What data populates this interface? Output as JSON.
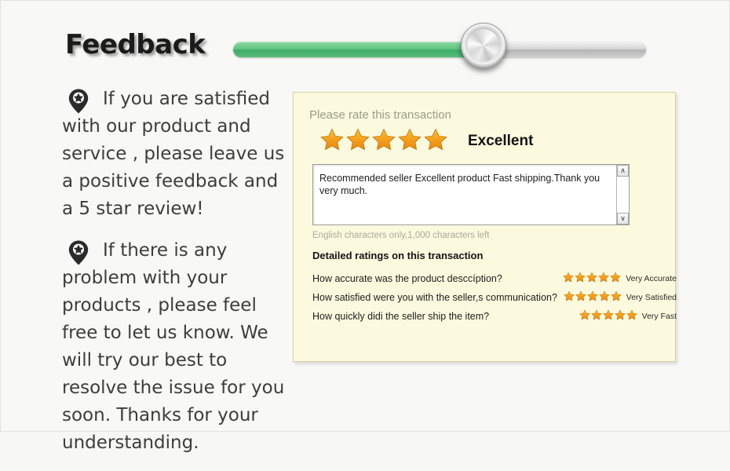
{
  "header": {
    "title": "Feedback",
    "slider": {
      "name": "progress-slider",
      "fill_color": "#58bd79",
      "track_color": "#cfcfcf",
      "value_percent": 61
    }
  },
  "left_column": {
    "bullets": [
      {
        "icon": "map-pin-star-icon",
        "text": "If you are satisfied with our product and service , please leave us a positive feedback and a 5 star review!"
      },
      {
        "icon": "map-pin-star-icon",
        "text": "If there is any problem with your products , please feel free to let us know. We will try our best to resolve the issue for you soon. Thanks for your understanding."
      }
    ]
  },
  "panel": {
    "background_color": "#fbfade",
    "border_color": "#d8d2a6",
    "rate_prompt": "Please rate this transaction",
    "star_rating": 5,
    "star_color": "#f2a01e",
    "rating_word": "Excellent",
    "comment": "Recommended seller Excellent product Fast shipping.Thank you very much.",
    "comment_placeholder": "",
    "chars_left": "English characters only,1,000 characters left",
    "detailed_title": "Detailed ratings on this transaction",
    "detailed_ratings": [
      {
        "question": "How accurate was the product desccíption?",
        "stars": 5,
        "value": "Very Accurate"
      },
      {
        "question": "How satisfied were you with the seller,s communication?",
        "stars": 5,
        "value": "Very Satisfied"
      },
      {
        "question": "How quickly didi the seller ship the item?",
        "stars": 5,
        "value": "Very Fast"
      }
    ],
    "scrollbar": {
      "up_glyph": "∧",
      "down_glyph": "∨"
    }
  }
}
